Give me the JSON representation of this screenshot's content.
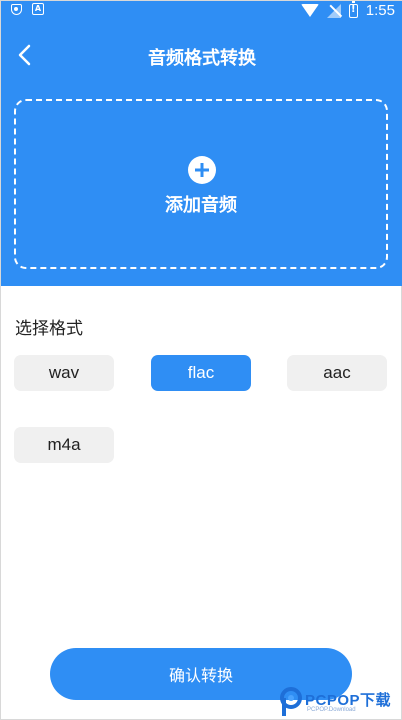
{
  "status_bar": {
    "time": "1:55",
    "icons": [
      "shield-icon",
      "a-box-icon",
      "wifi-icon",
      "signal-off-icon",
      "battery-alert-icon"
    ]
  },
  "header": {
    "back_icon": "chevron-left-icon",
    "title": "音频格式转换"
  },
  "upload": {
    "icon": "plus-circle-icon",
    "label": "添加音频"
  },
  "formats": {
    "title": "选择格式",
    "options": [
      "wav",
      "flac",
      "aac",
      "m4a"
    ],
    "selected": "flac"
  },
  "confirm": {
    "label": "确认转换"
  },
  "watermark": {
    "brand": "PCPOP下载",
    "sub": "PCPOP.Download"
  },
  "colors": {
    "accent": "#2f8ef4",
    "button_bg": "#f0f0f0",
    "text": "#222222"
  }
}
